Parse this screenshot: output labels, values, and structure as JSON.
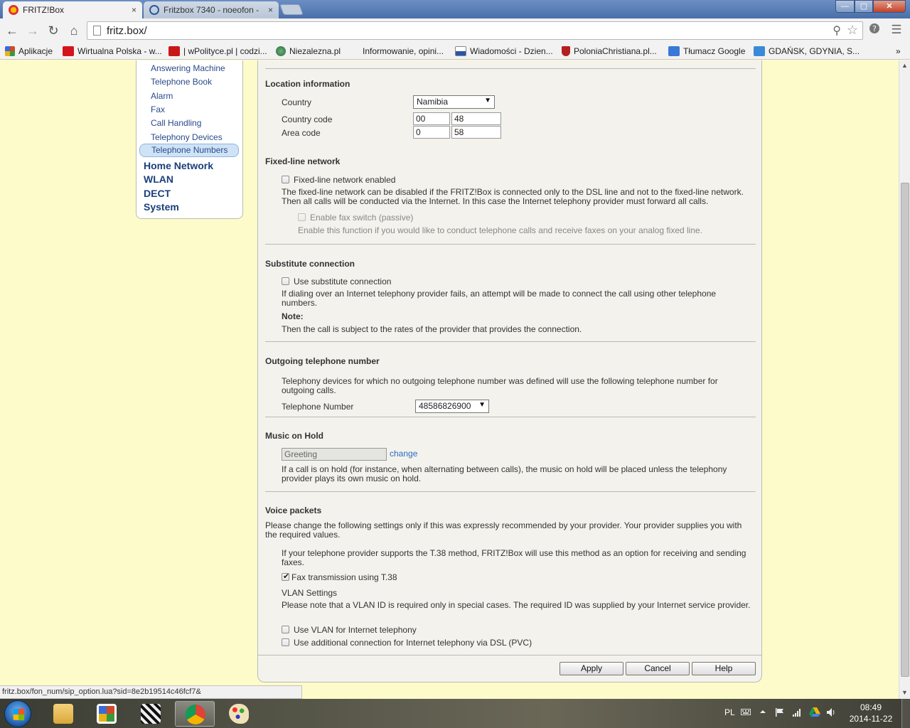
{
  "browser": {
    "tabs": [
      {
        "title": "FRITZ!Box",
        "active": true
      },
      {
        "title": "Fritzbox 7340 - noeofon - ",
        "active": false
      }
    ],
    "tab_close_glyph": "×",
    "window_buttons": {
      "minimize": "—",
      "maximize": "▢",
      "close": "✕"
    },
    "nav": {
      "back": "←",
      "forward": "→",
      "reload": "↻",
      "home": "⌂"
    },
    "address": "fritz.box/",
    "icons": {
      "zoom": "⚲",
      "star": "☆",
      "page": "page-icon",
      "menu": "☰"
    },
    "bookmarks": [
      {
        "label": "Aplikacje",
        "color": "#d04a2a"
      },
      {
        "label": "Wirtualna Polska - w...",
        "color": "#d4141c"
      },
      {
        "label": "| wPolityce.pl | codzi...",
        "color": "#c81818"
      },
      {
        "label": "Niezalezna.pl",
        "color": "#2a6a3a"
      },
      {
        "label": "Informowanie, opini...",
        "color": ""
      },
      {
        "label": "Wiadomości - Dzien...",
        "color": "#2a55a8"
      },
      {
        "label": "PoloniaChristiana.pl...",
        "color": "#b42020"
      },
      {
        "label": "Tłumacz Google",
        "color": "#3a78d8"
      },
      {
        "label": "GDAŃSK, GDYNIA, S...",
        "color": "#3a8ad8"
      }
    ],
    "bookmarks_overflow": "»",
    "status_url": "fritz.box/fon_num/sip_option.lua?sid=8e2b19514c46fcf7&"
  },
  "sidebar": {
    "subitems": [
      "Answering Machine",
      "Telephone Book",
      "Alarm",
      "Fax",
      "Call Handling",
      "Telephony Devices",
      "Telephone Numbers"
    ],
    "active_subitem": "Telephone Numbers",
    "main_items": [
      "Home Network",
      "WLAN",
      "DECT",
      "System"
    ]
  },
  "location": {
    "title": "Location information",
    "country_label": "Country",
    "country_value": "Namibia",
    "country_code_label": "Country code",
    "country_code_prefix": "00",
    "country_code_value": "48",
    "area_code_label": "Area code",
    "area_code_prefix": "0",
    "area_code_value": "58"
  },
  "fixed_line": {
    "title": "Fixed-line network",
    "enabled_label": "Fixed-line network enabled",
    "enabled": false,
    "description": "The fixed-line network can be disabled if the FRITZ!Box is connected only to the DSL line and not to the fixed-line network. Then all calls will be conducted via the Internet. In this case the Internet telephony provider must forward all calls.",
    "fax_switch_label": "Enable fax switch (passive)",
    "fax_switch_description": "Enable this function if you would like to conduct telephone calls and receive faxes on your analog fixed line."
  },
  "substitute": {
    "title": "Substitute connection",
    "use_label": "Use substitute connection",
    "enabled": false,
    "description": "If dialing over an Internet telephony provider fails, an attempt will be made to connect the call using other telephone numbers.",
    "note_label": "Note:",
    "note_text": "Then the call is subject to the rates of the provider that provides the connection."
  },
  "outgoing": {
    "title": "Outgoing telephone number",
    "description": "Telephony devices for which no outgoing telephone number was defined will use the following telephone number for outgoing calls.",
    "number_label": "Telephone Number",
    "number_value": "48586826900"
  },
  "music": {
    "title": "Music on Hold",
    "value": "Greeting",
    "change_link": "change",
    "description": "If a call is on hold (for instance, when alternating between calls), the music on hold will be placed unless the telephony provider plays its own music on hold."
  },
  "voice": {
    "title": "Voice packets",
    "intro": "Please change the following settings only if this was expressly recommended by your provider. Your provider supplies you with the required values.",
    "t38_description": "If your telephone provider supports the T.38 method, FRITZ!Box will use this method as an option for receiving and sending faxes.",
    "t38_label": "Fax transmission using T.38",
    "t38_checked": true,
    "vlan_title": "VLAN Settings",
    "vlan_note": "Please note that a VLAN ID is required only in special cases. The required ID was supplied by your Internet service provider.",
    "vlan_label": "Use VLAN for Internet telephony",
    "pvc_label": "Use additional connection for Internet telephony via DSL (PVC)"
  },
  "buttons": {
    "apply": "Apply",
    "cancel": "Cancel",
    "help": "Help"
  },
  "glyphs": {
    "dropdown": "▼",
    "check": "✔",
    "scroll_up": "▲",
    "scroll_down": "▼"
  },
  "taskbar": {
    "language": "PL",
    "time": "08:49",
    "date": "2014-11-22",
    "tray_icons": [
      "keyboard-icon",
      "show-hidden-icon",
      "flag-icon",
      "network-icon",
      "drive-icon",
      "volume-icon"
    ]
  }
}
